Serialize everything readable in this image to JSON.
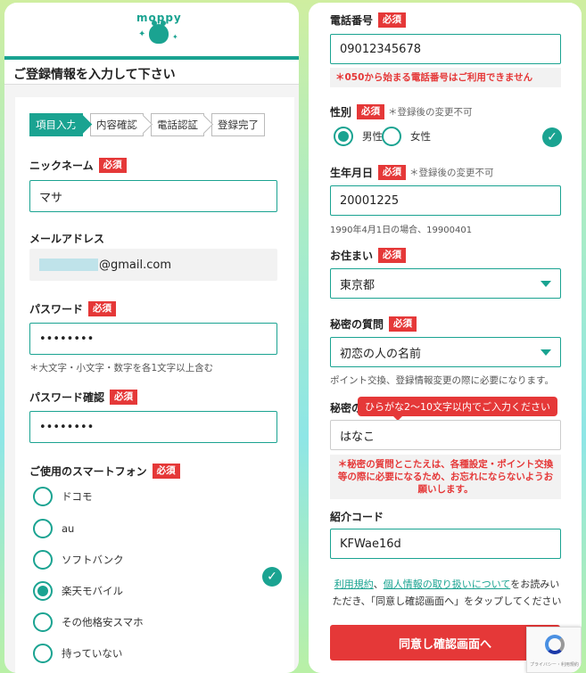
{
  "left": {
    "logo": "moppy",
    "page_title": "ご登録情報を入力して下さい",
    "steps": [
      "項目入力",
      "内容確認",
      "電話認証",
      "登録完了"
    ],
    "required_label": "必須",
    "nickname": {
      "label": "ニックネーム",
      "value": "マサ"
    },
    "email": {
      "label": "メールアドレス",
      "value": "@gmail.com"
    },
    "password": {
      "label": "パスワード",
      "value": "••••••••",
      "hint": "＊大文字・小文字・数字を各1文字以上含む"
    },
    "password_confirm": {
      "label": "パスワード確認",
      "value": "••••••••"
    },
    "smartphone": {
      "label": "ご使用のスマートフォン",
      "options": [
        "ドコモ",
        "au",
        "ソフトバンク",
        "楽天モバイル",
        "その他格安スマホ",
        "持っていない"
      ],
      "selected": "楽天モバイル"
    }
  },
  "right": {
    "required_label": "必須",
    "phone": {
      "label": "電話番号",
      "value": "09012345678",
      "error": "＊050から始まる電話番号はご利用できません"
    },
    "gender": {
      "label": "性別",
      "note": "＊登録後の変更不可",
      "options": [
        "男性",
        "女性"
      ],
      "selected": "男性"
    },
    "birthday": {
      "label": "生年月日",
      "note": "＊登録後の変更不可",
      "value": "20001225",
      "hint": "1990年4月1日の場合、19900401"
    },
    "residence": {
      "label": "お住まい",
      "value": "東京都"
    },
    "secret_question": {
      "label": "秘密の質問",
      "value": "初恋の人の名前",
      "hint": "ポイント交換、登録情報変更の際に必要になります。"
    },
    "secret_answer": {
      "label": "秘密の",
      "tooltip": "ひらがな2〜10文字以内でご入力ください",
      "value": "はなこ",
      "error": "＊秘密の質問とこたえは、各種設定・ポイント交換等の際に必要になるため、お忘れにならないようお願いします。"
    },
    "referral": {
      "label": "紹介コード",
      "value": "KFWae16d"
    },
    "terms": {
      "link1": "利用規約",
      "sep": "、",
      "link2": "個人情報の取り扱いについて",
      "text": "をお読みいただき、「同意し確認画面へ」をタップしてください"
    },
    "submit_label": "同意し確認画面へ",
    "recaptcha_text": "プライバシー・利用規約"
  },
  "colors": {
    "accent": "#1aa391",
    "error": "#e53838"
  },
  "icons": [
    "check-circle-icon",
    "dropdown-arrow-icon",
    "recaptcha-icon"
  ]
}
